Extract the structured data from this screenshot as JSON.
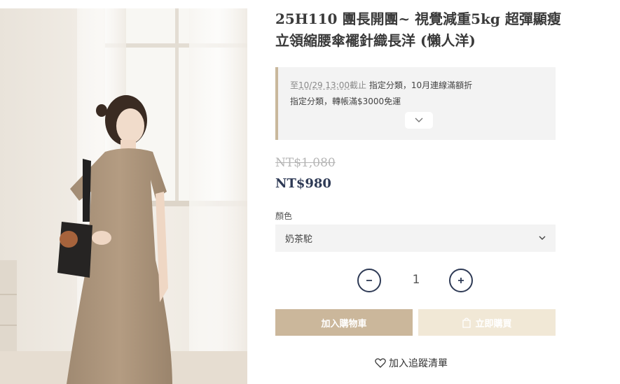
{
  "product": {
    "title": "25H110 團長開團~ 視覺減重5kg 超彈顯瘦立領縮腰傘襬針織長洋 (懶人洋)",
    "image_alt": "product-photo"
  },
  "promo": {
    "line1_prefix": "至",
    "line1_deadline": "10/29 13:00",
    "line1_suffix": "截止",
    "line1_text": "指定分類，10月連線滿額折",
    "line2_text": "指定分類，轉帳滿$3000免運"
  },
  "price": {
    "original": "NT$1,080",
    "sale": "NT$980"
  },
  "option": {
    "label": "顏色",
    "selected": "奶茶駝"
  },
  "quantity": {
    "value": "1"
  },
  "actions": {
    "add_to_cart": "加入購物車",
    "buy_now": "立即購買",
    "wishlist": "加入追蹤清單"
  },
  "colors": {
    "accent_navy": "#2e3a55",
    "cart_button": "#cbb79b",
    "buy_button": "#f1e8d6",
    "promo_border": "#c9b89c"
  },
  "icons": {
    "expand": "chevron-down-icon",
    "select": "chevron-down-icon",
    "minus": "minus-icon",
    "plus": "plus-icon",
    "buy": "shopping-bag-icon",
    "wishlist": "heart-icon"
  }
}
